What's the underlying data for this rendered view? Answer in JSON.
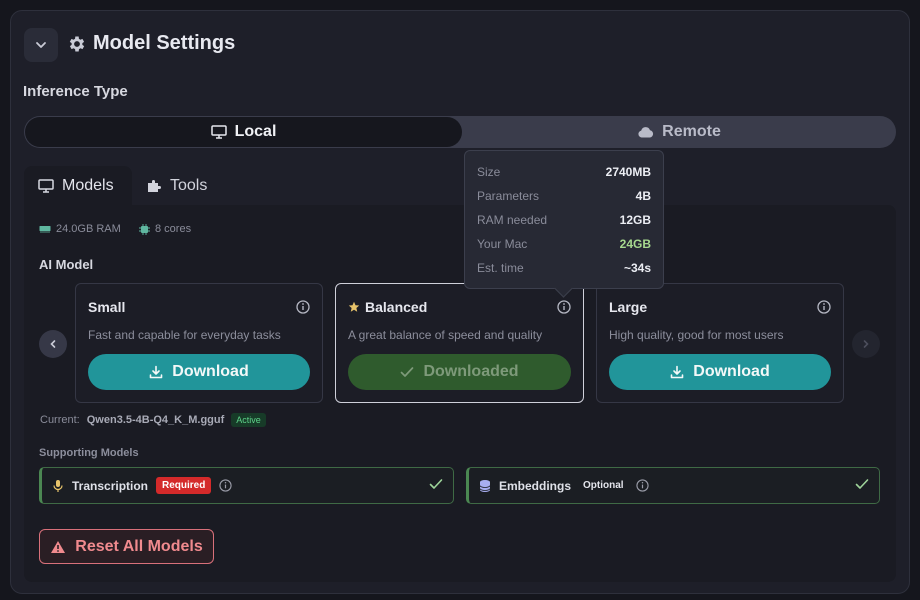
{
  "header": {
    "title": "Model Settings"
  },
  "inference": {
    "label": "Inference Type",
    "options": {
      "local": "Local",
      "remote": "Remote"
    },
    "selected": "Local"
  },
  "tabs": {
    "models": "Models",
    "tools": "Tools"
  },
  "system": {
    "ram": "24.0GB RAM",
    "cores": "8 cores"
  },
  "ai_model_label": "AI Model",
  "models": [
    {
      "name": "Small",
      "desc": "Fast and capable for everyday tasks",
      "button": "Download",
      "state": "download"
    },
    {
      "name": "Balanced",
      "desc": "A great balance of speed and quality",
      "button": "Downloaded",
      "state": "downloaded"
    },
    {
      "name": "Large",
      "desc": "High quality, good for most users",
      "button": "Download",
      "state": "download"
    }
  ],
  "tooltip": {
    "size_label": "Size",
    "size_value": "2740MB",
    "params_label": "Parameters",
    "params_value": "4B",
    "ram_label": "RAM needed",
    "ram_value": "12GB",
    "mac_label": "Your Mac",
    "mac_value": "24GB",
    "time_label": "Est. time",
    "time_value": "~34s"
  },
  "current": {
    "label": "Current:",
    "file": "Qwen3.5-4B-Q4_K_M.gguf",
    "badge": "Active"
  },
  "supporting": {
    "label": "Supporting Models",
    "transcription": {
      "name": "Transcription",
      "badge": "Required"
    },
    "embeddings": {
      "name": "Embeddings",
      "badge": "Optional"
    }
  },
  "reset_label": "Reset All Models",
  "colors": {
    "accent": "#21959a",
    "success": "#5ed38a",
    "danger": "#d42a2a"
  }
}
